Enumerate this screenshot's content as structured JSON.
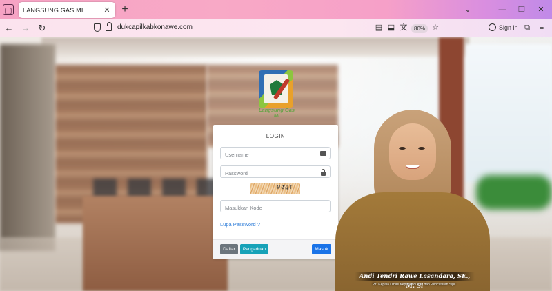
{
  "browser": {
    "tab_title": "LANGSUNG GAS MI",
    "url": "dukcapilkabkonawe.com",
    "zoom": "80%",
    "signin_label": "Sign in"
  },
  "logo": {
    "text": "Langsung Gas Mi"
  },
  "login": {
    "title": "LOGIN",
    "username_placeholder": "Username",
    "password_placeholder": "Password",
    "captcha_text": "9ℭg↑",
    "kode_placeholder": "Masukkan Kode",
    "forgot_label": "Lupa Password ?",
    "daftar_label": "Daftar",
    "pengaduan_label": "Pengaduan",
    "masuk_label": "Masuk"
  },
  "official": {
    "name": "Andi Tendri Rawe Lasandara, SE., M. Si",
    "role": "Plt. Kepala Dinas Kependudukan dan Pencatatan Sipil"
  },
  "colors": {
    "primary": "#1a73e8",
    "info": "#17a2b8",
    "secondary": "#6c757d",
    "link": "#2b7bd8"
  }
}
